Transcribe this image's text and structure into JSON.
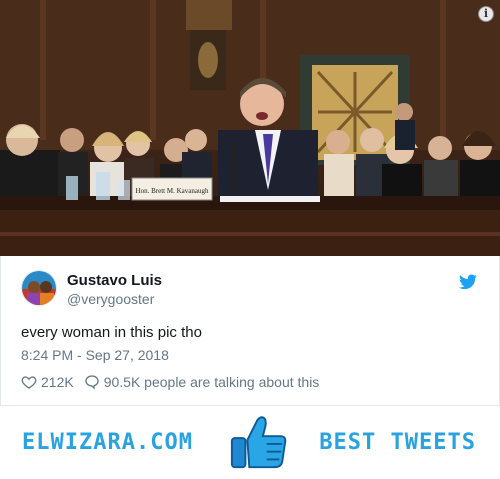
{
  "photo": {
    "nameplate_text": "Hon. Brett M. Kavanaugh",
    "info_symbol": "i"
  },
  "tweet": {
    "user_name": "Gustavo Luis",
    "user_handle": "@verygooster",
    "text": "every woman in this pic tho",
    "timestamp": "8:24 PM - Sep 27, 2018",
    "likes": "212K",
    "replies": "90.5K people are talking about this"
  },
  "footer": {
    "left_text": "ELWIZARA.COM",
    "right_text": "BEST TWEETS"
  },
  "icons": {
    "info": "info-icon",
    "bird": "twitter-bird-icon",
    "like": "heart-icon",
    "reply": "speech-bubble-icon",
    "thumb": "thumbs-up-icon"
  },
  "colors": {
    "twitter_blue": "#1da1f2",
    "brand_blue": "#29a3e0",
    "muted_text": "#657786"
  }
}
